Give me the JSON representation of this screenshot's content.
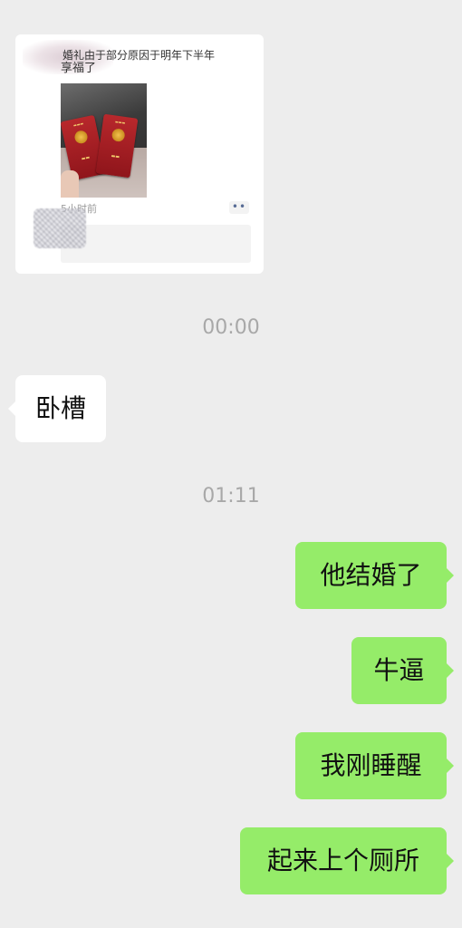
{
  "colors": {
    "background": "#ededed",
    "incoming_bubble": "#ffffff",
    "outgoing_bubble": "#95ec69",
    "timestamp_text": "#a8a8a8"
  },
  "moment_card": {
    "caption": "享福了",
    "photo": "marriage-certificates-photo",
    "time_ago": "5小时前",
    "more_icon": "more-dots-icon",
    "more_glyph": "••",
    "comment_text": "婚礼由于部分原因于明年下半年"
  },
  "messages": [
    {
      "type": "timestamp",
      "text": "00:00"
    },
    {
      "type": "incoming",
      "text": "卧槽"
    },
    {
      "type": "timestamp",
      "text": "01:11"
    },
    {
      "type": "outgoing",
      "text": "他结婚了"
    },
    {
      "type": "outgoing",
      "text": "牛逼"
    },
    {
      "type": "outgoing",
      "text": "我刚睡醒"
    },
    {
      "type": "outgoing",
      "text": "起来上个厕所"
    }
  ]
}
